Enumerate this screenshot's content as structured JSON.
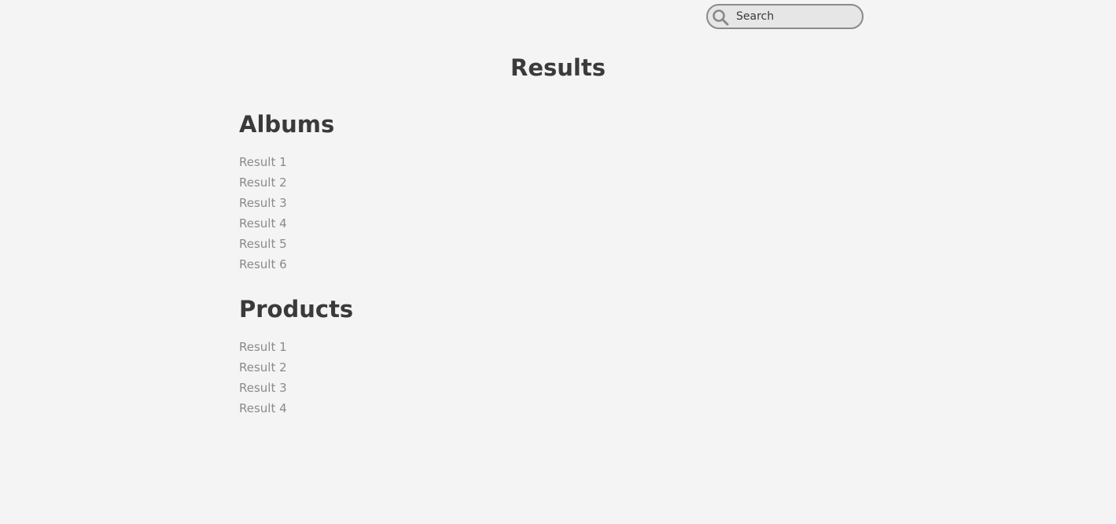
{
  "search": {
    "placeholder": "Search",
    "icon": "search-icon"
  },
  "page": {
    "title": "Results"
  },
  "sections": [
    {
      "heading": "Albums",
      "results": [
        "Result 1",
        "Result 2",
        "Result 3",
        "Result 4",
        "Result 5",
        "Result 6"
      ]
    },
    {
      "heading": "Products",
      "results": [
        "Result 1",
        "Result 2",
        "Result 3",
        "Result 4"
      ]
    }
  ],
  "colors": {
    "background": "#f4f4f4",
    "heading": "#3a3a3a",
    "link": "#8a8a8a",
    "search_border": "#8a8a8a",
    "search_fill": "#e6e6e6"
  }
}
